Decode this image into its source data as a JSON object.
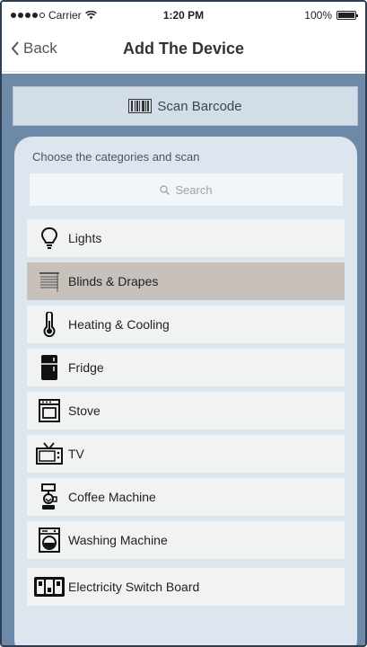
{
  "status_bar": {
    "carrier": "Carrier",
    "time": "1:20 PM",
    "battery": "100%"
  },
  "nav": {
    "back_label": "Back",
    "title": "Add The Device"
  },
  "scan_button": {
    "label": "Scan Barcode",
    "icon": "barcode-icon"
  },
  "categories": {
    "heading": "Choose the categories and scan",
    "search_placeholder": "Search",
    "items": [
      {
        "label": "Lights",
        "icon": "lightbulb-icon",
        "selected": false
      },
      {
        "label": "Blinds & Drapes",
        "icon": "blinds-icon",
        "selected": true
      },
      {
        "label": "Heating & Cooling",
        "icon": "thermometer-icon",
        "selected": false
      },
      {
        "label": "Fridge",
        "icon": "fridge-icon",
        "selected": false
      },
      {
        "label": "Stove",
        "icon": "stove-icon",
        "selected": false
      },
      {
        "label": "TV",
        "icon": "tv-icon",
        "selected": false
      },
      {
        "label": "Coffee Machine",
        "icon": "coffee-machine-icon",
        "selected": false
      },
      {
        "label": "Washing Machine",
        "icon": "washing-machine-icon",
        "selected": false
      },
      {
        "label": "Electricity Switch Board",
        "icon": "switch-board-icon",
        "selected": false
      }
    ]
  },
  "colors": {
    "background": "#6d89a8",
    "panel": "#dde5ee",
    "item": "#f1f2f2",
    "selected_item": "#c8c1bb"
  }
}
